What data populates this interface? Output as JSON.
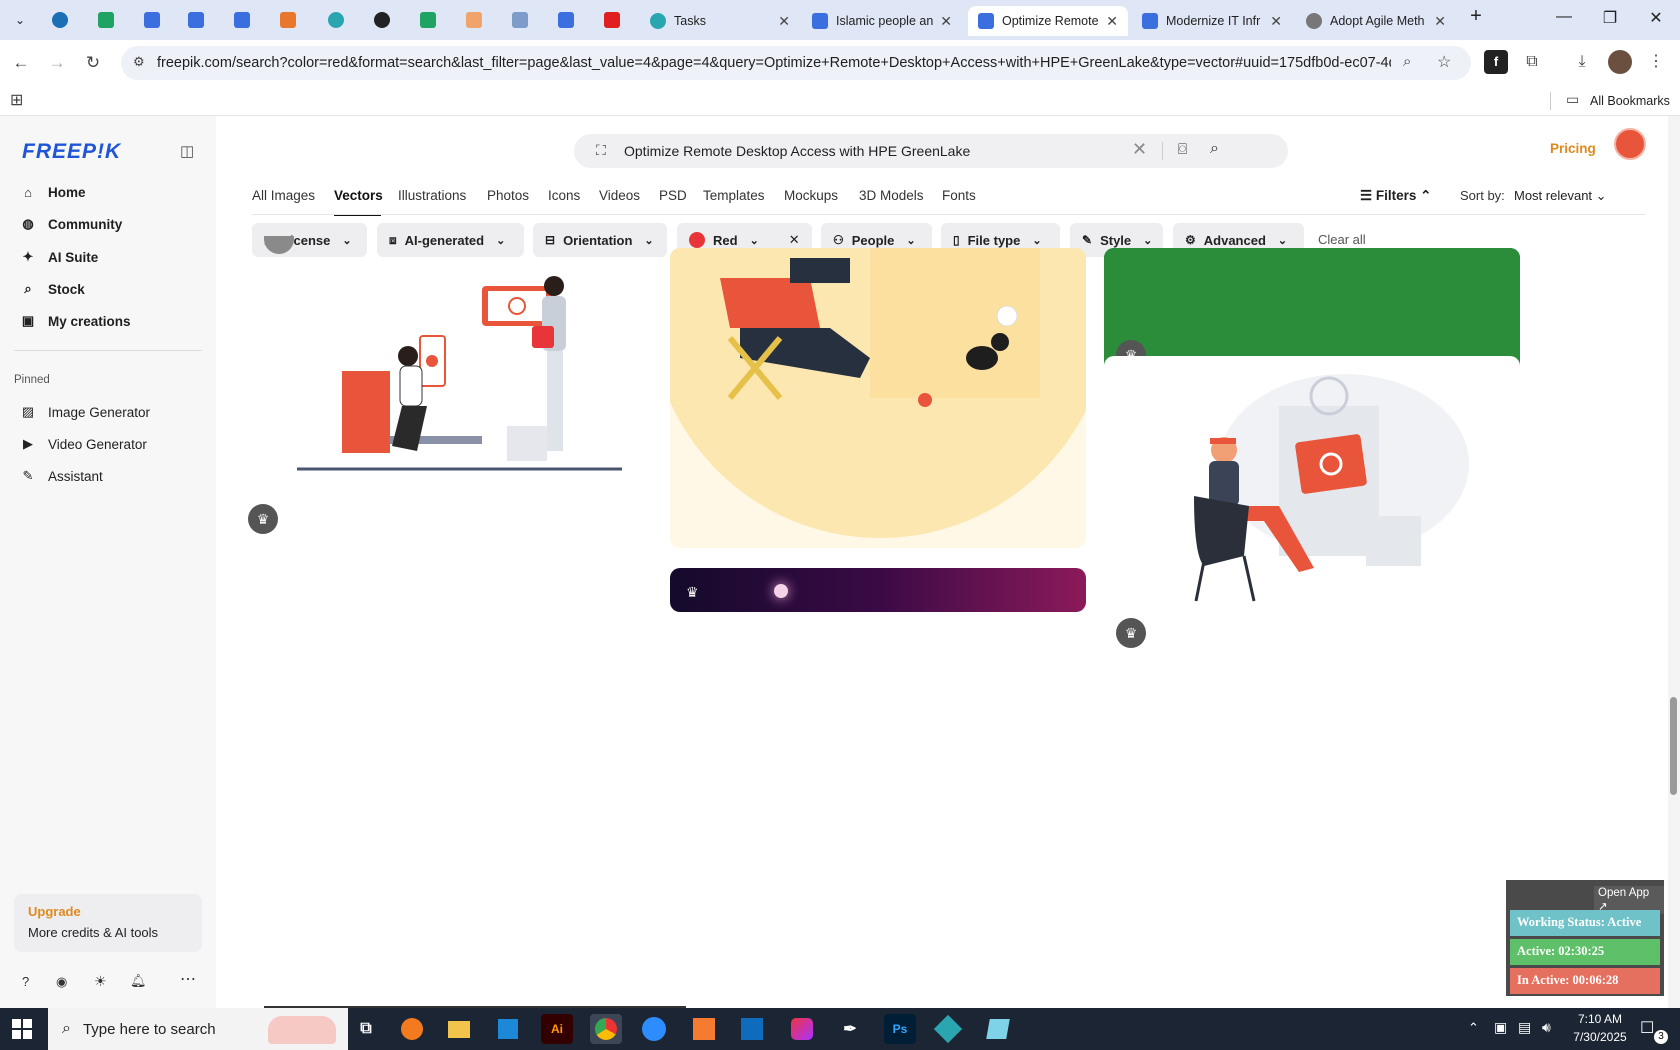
{
  "browser": {
    "tabs": [
      {
        "title": "Tasks",
        "icon_color": "#2aa6b0"
      },
      {
        "title": "Islamic people an",
        "icon_color": "#3b6fe0"
      },
      {
        "title": "Optimize Remote",
        "icon_color": "#3b6fe0",
        "active": true
      },
      {
        "title": "Modernize IT Infr",
        "icon_color": "#3b6fe0"
      },
      {
        "title": "Adopt Agile Meth",
        "icon_color": "#777777"
      }
    ],
    "url": "freepik.com/search?color=red&format=search&last_filter=page&last_value=4&page=4&query=Optimize+Remote+Desktop+Access+with+HPE+GreenLake&type=vector#uuid=175dfb0d-ec07-4dd...",
    "all_bookmarks": "All Bookmarks"
  },
  "sidebar": {
    "logo": "FREEP!K",
    "nav": [
      {
        "label": "Home",
        "icon": "home-icon",
        "glyph": "⌂"
      },
      {
        "label": "Community",
        "icon": "globe-icon",
        "glyph": "◍"
      },
      {
        "label": "AI Suite",
        "icon": "sparkle-icon",
        "glyph": "✦"
      },
      {
        "label": "Stock",
        "icon": "search-icon",
        "glyph": "⌕"
      },
      {
        "label": "My creations",
        "icon": "folder-icon",
        "glyph": "▣"
      }
    ],
    "pinned_label": "Pinned",
    "pinned": [
      {
        "label": "Image Generator",
        "icon": "image-icon",
        "glyph": "▨"
      },
      {
        "label": "Video Generator",
        "icon": "video-icon",
        "glyph": "▶"
      },
      {
        "label": "Assistant",
        "icon": "chat-icon",
        "glyph": "✎"
      }
    ],
    "upgrade": {
      "title": "Upgrade",
      "subtitle": "More credits & AI tools"
    }
  },
  "search": {
    "query": "Optimize Remote Desktop Access with HPE GreenLake"
  },
  "header": {
    "pricing": "Pricing"
  },
  "categories": [
    "All Images",
    "Vectors",
    "Illustrations",
    "Photos",
    "Icons",
    "Videos",
    "PSD",
    "Templates",
    "Mockups",
    "3D Models",
    "Fonts"
  ],
  "active_category": "Vectors",
  "filters_label": "Filters",
  "sort": {
    "label": "Sort by:",
    "value": "Most relevant"
  },
  "chips": [
    {
      "label": "License",
      "icon": "license-icon"
    },
    {
      "label": "AI-generated",
      "icon": "ai-icon"
    },
    {
      "label": "Orientation",
      "icon": "orientation-icon"
    },
    {
      "label": "Red",
      "icon": "color-swatch",
      "color": "#e8353a"
    },
    {
      "label": "People",
      "icon": "people-icon"
    },
    {
      "label": "File type",
      "icon": "file-icon"
    },
    {
      "label": "Style",
      "icon": "style-icon"
    },
    {
      "label": "Advanced",
      "icon": "gear-icon"
    }
  ],
  "clear_all": "Clear all",
  "tracker": {
    "open_app": "Open App ↗",
    "status": "Working Status: Active",
    "active": "Active: 02:30:25",
    "inactive": "In Active: 00:06:28",
    "colors": {
      "status": "#6fc3c8",
      "active": "#5fc06a",
      "inactive": "#e5705f"
    }
  },
  "taskbar": {
    "search_placeholder": "Type here to search",
    "time": "7:10 AM",
    "date": "7/30/2025",
    "notifications": "3"
  }
}
